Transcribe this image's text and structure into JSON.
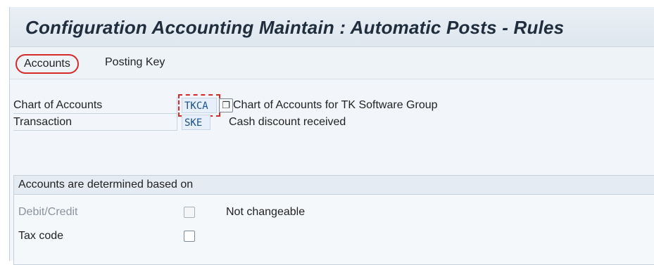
{
  "window": {
    "title": "Configuration Accounting Maintain : Automatic Posts - Rules"
  },
  "toolbar": {
    "accounts_label": "Accounts",
    "posting_key_label": "Posting Key"
  },
  "fields": {
    "chart_of_accounts": {
      "label": "Chart of Accounts",
      "value": "TKCA",
      "description": "Chart of Accounts for TK Software Group"
    },
    "transaction": {
      "label": "Transaction",
      "value": "SKE",
      "description": "Cash discount received"
    }
  },
  "group": {
    "title": "Accounts are determined based on",
    "debit_credit": {
      "label": "Debit/Credit",
      "checked": false,
      "enabled": false,
      "note": "Not changeable"
    },
    "tax_code": {
      "label": "Tax code",
      "checked": false,
      "enabled": true
    }
  },
  "colors": {
    "highlight": "#d42a2a",
    "field_text": "#1a4f8a",
    "background": "#f2f6fa"
  }
}
